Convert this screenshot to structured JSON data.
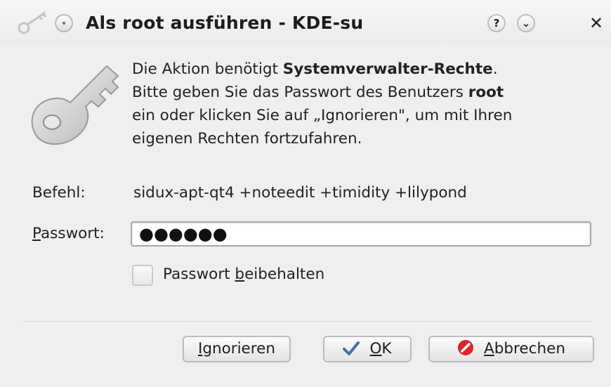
{
  "window": {
    "title": "Als root ausführen - KDE-su",
    "help_glyph": "?",
    "minimize_glyph": "⌄",
    "close_glyph": "✕",
    "icons": [
      "key-icon",
      "pin-icon",
      "help-icon",
      "minimize-icon",
      "close-icon"
    ]
  },
  "message": {
    "line1_pre": "Die Aktion benötigt ",
    "line1_bold": "Systemverwalter-Rechte",
    "line1_post": ".",
    "line2_pre": "Bitte geben Sie das Passwort des Benutzers ",
    "line2_bold": "root",
    "line3": "ein oder klicken Sie auf „Ignorieren\", um mit Ihren",
    "line4": "eigenen Rechten fortzufahren."
  },
  "command": {
    "label": "Befehl:",
    "value": "sidux-apt-qt4 +noteedit +timidity +lilypond"
  },
  "password": {
    "label_first": "P",
    "label_rest": "asswort:",
    "value_masked": "●●●●●●"
  },
  "keep_password": {
    "label_pre": "Passwort ",
    "label_u": "b",
    "label_post": "eibehalten",
    "checked": false
  },
  "buttons": {
    "ignore": {
      "u": "I",
      "rest": "gnorieren"
    },
    "ok": {
      "u": "O",
      "rest": "K",
      "icon": "checkmark-icon",
      "icon_color": "#4a6fa5"
    },
    "cancel": {
      "u": "A",
      "rest": "bbrechen",
      "icon": "cancel-icon",
      "icon_color": "#d9262b"
    }
  }
}
